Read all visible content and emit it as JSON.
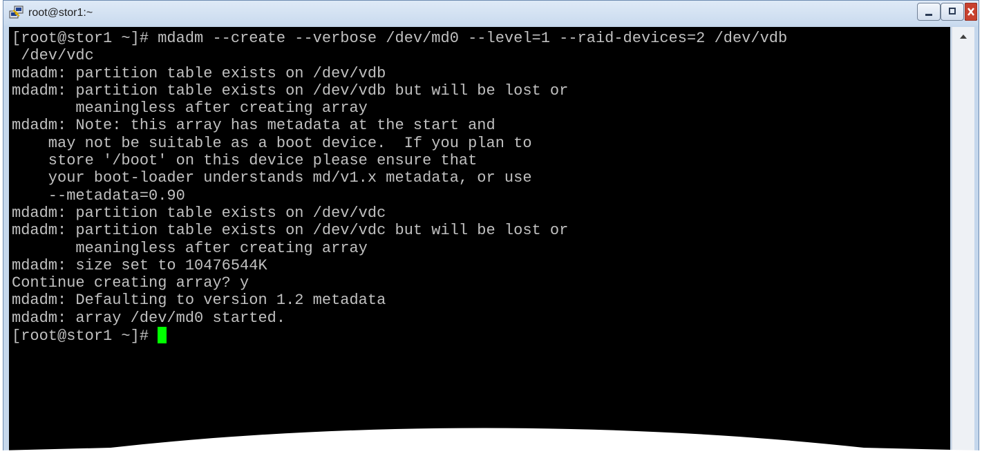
{
  "window": {
    "title": "root@stor1:~",
    "app_icon": "putty-icon"
  },
  "controls": {
    "minimize": "minimize-icon",
    "maximize": "maximize-icon",
    "close": "close-icon"
  },
  "terminal": {
    "lines": [
      "[root@stor1 ~]# mdadm --create --verbose /dev/md0 --level=1 --raid-devices=2 /dev/vdb",
      " /dev/vdc",
      "mdadm: partition table exists on /dev/vdb",
      "mdadm: partition table exists on /dev/vdb but will be lost or",
      "       meaningless after creating array",
      "mdadm: Note: this array has metadata at the start and",
      "    may not be suitable as a boot device.  If you plan to",
      "    store '/boot' on this device please ensure that",
      "    your boot-loader understands md/v1.x metadata, or use",
      "    --metadata=0.90",
      "mdadm: partition table exists on /dev/vdc",
      "mdadm: partition table exists on /dev/vdc but will be lost or",
      "       meaningless after creating array",
      "mdadm: size set to 10476544K",
      "Continue creating array? y",
      "mdadm: Defaulting to version 1.2 metadata",
      "mdadm: array /dev/md0 started."
    ],
    "prompt": "[root@stor1 ~]# ",
    "cursor_color": "#00ff00",
    "text_color": "#c0c0c0",
    "background_color": "#000000"
  },
  "scrollbar": {
    "up_arrow": "scroll-up-arrow-icon"
  }
}
